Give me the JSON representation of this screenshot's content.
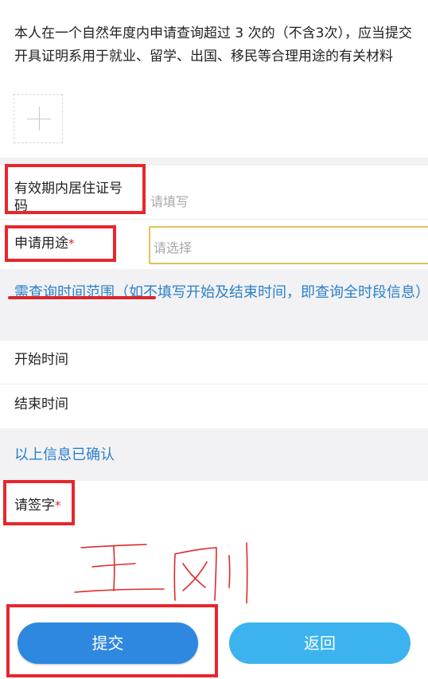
{
  "notice": {
    "text": "本人在一个自然年度内申请查询超过 3 次的（不含3次），应当提交开具证明系用于就业、留学、出国、移民等合理用途的有关材料",
    "upload_icon": "plus-icon"
  },
  "form": {
    "residence_permit": {
      "label": "有效期内居住证号码",
      "placeholder": "请填写"
    },
    "purpose": {
      "label": "申请用途",
      "required_mark": "*",
      "placeholder": "请选择"
    }
  },
  "time_range": {
    "title": "需查询时间范围（如不填写开始及结束时间，即查询全时段信息）",
    "start_label": "开始时间",
    "end_label": "结束时间"
  },
  "confirm": {
    "title": "以上信息已确认",
    "signature_label": "请签字",
    "required_mark": "*"
  },
  "buttons": {
    "submit_label": "提交",
    "back_label": "返回"
  },
  "colors": {
    "accent_blue": "#2c80c9",
    "submit_button": "#2f88df",
    "back_button": "#3cb3ee",
    "annotation_red": "#e8262c",
    "required_star": "#d9262c"
  }
}
